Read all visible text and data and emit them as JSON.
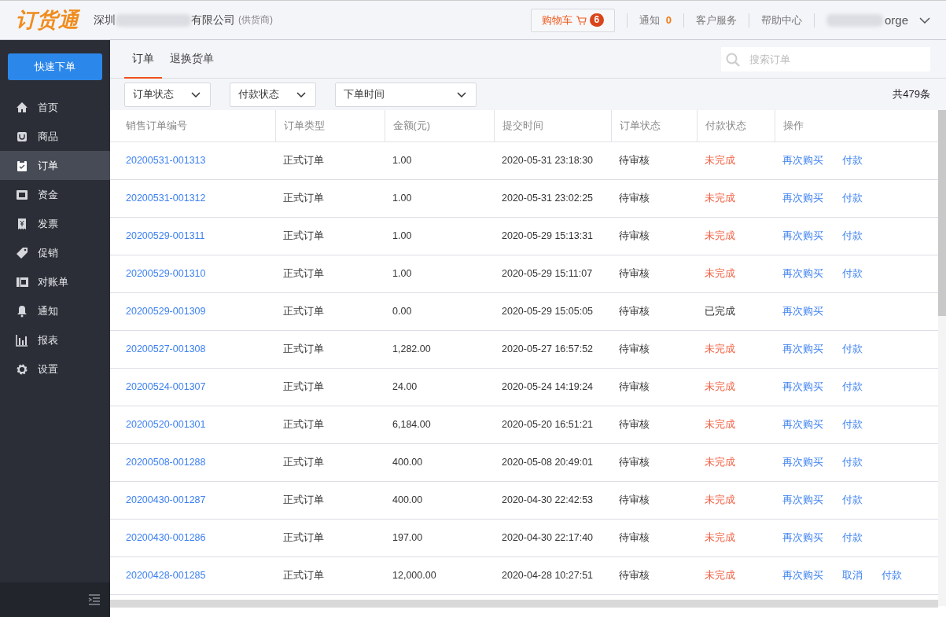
{
  "header": {
    "logo": "订货通",
    "company_start": "深圳",
    "company_end": "有限公司",
    "company_role": "(供货商)",
    "cart": {
      "label": "购物车",
      "count": "6"
    },
    "notice": {
      "label": "通知",
      "count": "0"
    },
    "links": [
      "客户服务",
      "帮助中心"
    ],
    "user_end": "orge"
  },
  "sidebar": {
    "quick_order": "快速下单",
    "items": [
      {
        "label": "首页",
        "selected": false
      },
      {
        "label": "商品",
        "selected": false
      },
      {
        "label": "订单",
        "selected": true
      },
      {
        "label": "资金",
        "selected": false
      },
      {
        "label": "发票",
        "selected": false
      },
      {
        "label": "促销",
        "selected": false
      },
      {
        "label": "对账单",
        "selected": false
      },
      {
        "label": "通知",
        "selected": false
      },
      {
        "label": "报表",
        "selected": false
      },
      {
        "label": "设置",
        "selected": false
      }
    ]
  },
  "tabs": [
    {
      "label": "订单",
      "selected": true
    },
    {
      "label": "退换货单",
      "selected": false
    }
  ],
  "search": {
    "placeholder": "搜索订单"
  },
  "filters": [
    "订单状态",
    "付款状态",
    "下单时间"
  ],
  "total": "共479条",
  "table": {
    "columns": [
      "销售订单编号",
      "订单类型",
      "金额(元)",
      "提交时间",
      "订单状态",
      "付款状态",
      "操作"
    ],
    "rows": [
      {
        "id": "20200531-001313",
        "type": "正式订单",
        "amount": "1.00",
        "time": "2020-05-31 23:18:30",
        "status": "待审核",
        "payment": "未完成",
        "paid": false,
        "actions": [
          "再次购买",
          "付款"
        ]
      },
      {
        "id": "20200531-001312",
        "type": "正式订单",
        "amount": "1.00",
        "time": "2020-05-31 23:02:25",
        "status": "待审核",
        "payment": "未完成",
        "paid": false,
        "actions": [
          "再次购买",
          "付款"
        ]
      },
      {
        "id": "20200529-001311",
        "type": "正式订单",
        "amount": "1.00",
        "time": "2020-05-29 15:13:31",
        "status": "待审核",
        "payment": "未完成",
        "paid": false,
        "actions": [
          "再次购买",
          "付款"
        ]
      },
      {
        "id": "20200529-001310",
        "type": "正式订单",
        "amount": "1.00",
        "time": "2020-05-29 15:11:07",
        "status": "待审核",
        "payment": "未完成",
        "paid": false,
        "actions": [
          "再次购买",
          "付款"
        ]
      },
      {
        "id": "20200529-001309",
        "type": "正式订单",
        "amount": "0.00",
        "time": "2020-05-29 15:05:05",
        "status": "待审核",
        "payment": "已完成",
        "paid": true,
        "actions": [
          "再次购买"
        ]
      },
      {
        "id": "20200527-001308",
        "type": "正式订单",
        "amount": "1,282.00",
        "time": "2020-05-27 16:57:52",
        "status": "待审核",
        "payment": "未完成",
        "paid": false,
        "actions": [
          "再次购买",
          "付款"
        ]
      },
      {
        "id": "20200524-001307",
        "type": "正式订单",
        "amount": "24.00",
        "time": "2020-05-24 14:19:24",
        "status": "待审核",
        "payment": "未完成",
        "paid": false,
        "actions": [
          "再次购买",
          "付款"
        ]
      },
      {
        "id": "20200520-001301",
        "type": "正式订单",
        "amount": "6,184.00",
        "time": "2020-05-20 16:51:21",
        "status": "待审核",
        "payment": "未完成",
        "paid": false,
        "actions": [
          "再次购买",
          "付款"
        ]
      },
      {
        "id": "20200508-001288",
        "type": "正式订单",
        "amount": "400.00",
        "time": "2020-05-08 20:49:01",
        "status": "待审核",
        "payment": "未完成",
        "paid": false,
        "actions": [
          "再次购买",
          "付款"
        ]
      },
      {
        "id": "20200430-001287",
        "type": "正式订单",
        "amount": "400.00",
        "time": "2020-04-30 22:42:53",
        "status": "待审核",
        "payment": "未完成",
        "paid": false,
        "actions": [
          "再次购买",
          "付款"
        ]
      },
      {
        "id": "20200430-001286",
        "type": "正式订单",
        "amount": "197.00",
        "time": "2020-04-30 22:17:40",
        "status": "待审核",
        "payment": "未完成",
        "paid": false,
        "actions": [
          "再次购买",
          "付款"
        ]
      },
      {
        "id": "20200428-001285",
        "type": "正式订单",
        "amount": "12,000.00",
        "time": "2020-04-28 10:27:51",
        "status": "待审核",
        "payment": "未完成",
        "paid": false,
        "actions": [
          "再次购买",
          "取消",
          "付款"
        ]
      }
    ]
  }
}
